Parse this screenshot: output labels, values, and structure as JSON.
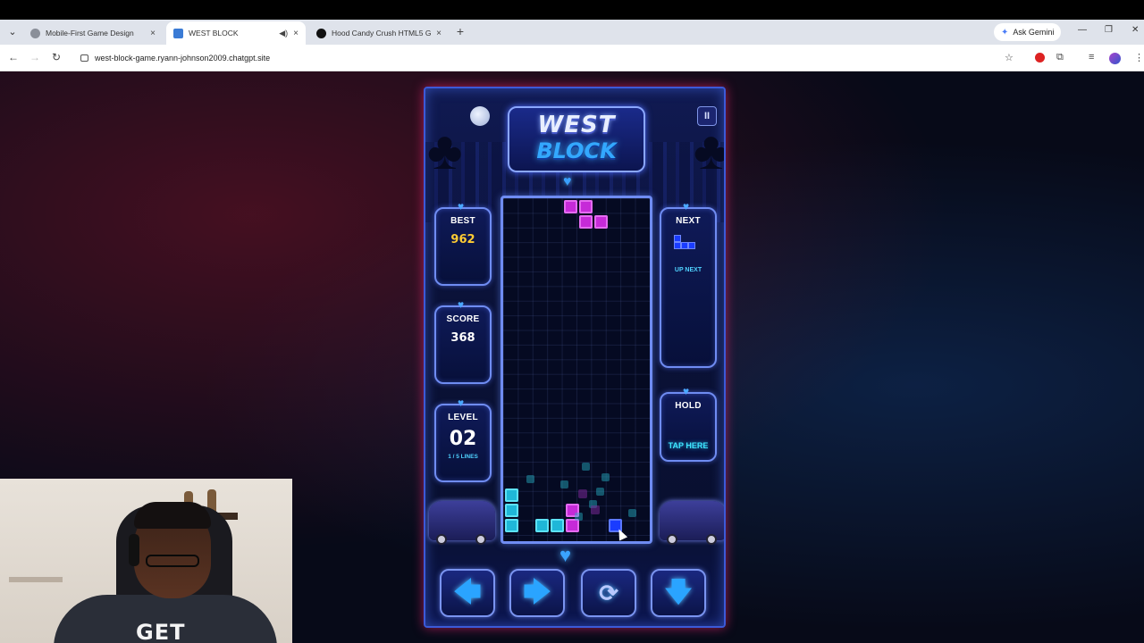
{
  "browser": {
    "tabs": [
      {
        "title": "Mobile-First Game Design",
        "active": false
      },
      {
        "title": "WEST BLOCK",
        "active": true
      },
      {
        "title": "Hood Candy Crush HTML5 Gar",
        "active": false
      }
    ],
    "new_tab_label": "+",
    "gemini_label": "Ask Gemini",
    "url": "west-block-game.ryann-johnson2009.chatgpt.site",
    "close_glyph": "×",
    "icons": [
      "back-icon",
      "forward-icon",
      "reload-icon",
      "star-icon",
      "extension-icon",
      "media-icon",
      "profile-icon",
      "menu-icon"
    ]
  },
  "game": {
    "logo_line1": "WEST",
    "logo_line2": "BLOCK",
    "pause_glyph": "II",
    "best": {
      "label": "BEST",
      "value": "962"
    },
    "score": {
      "label": "SCORE",
      "value": "368"
    },
    "level": {
      "label": "LEVEL",
      "value": "02",
      "progress": "1 / 5 LINES"
    },
    "next": {
      "label": "NEXT",
      "caption": "UP NEXT",
      "piece": "J"
    },
    "hold": {
      "label": "HOLD",
      "caption": "TAP HERE"
    },
    "controls": {
      "left": "🡄",
      "right": "🡆",
      "rotate": "⟳",
      "down": "🡇"
    },
    "colors": {
      "accent": "#3c5ad8",
      "gold": "#ffcc33",
      "cyan": "#4fd2ff",
      "piece_purple": "#c62ad8",
      "piece_cyan": "#1fb7d8",
      "piece_blue": "#1a3cff"
    }
  },
  "webcam": {
    "shirt_text": "GET"
  }
}
